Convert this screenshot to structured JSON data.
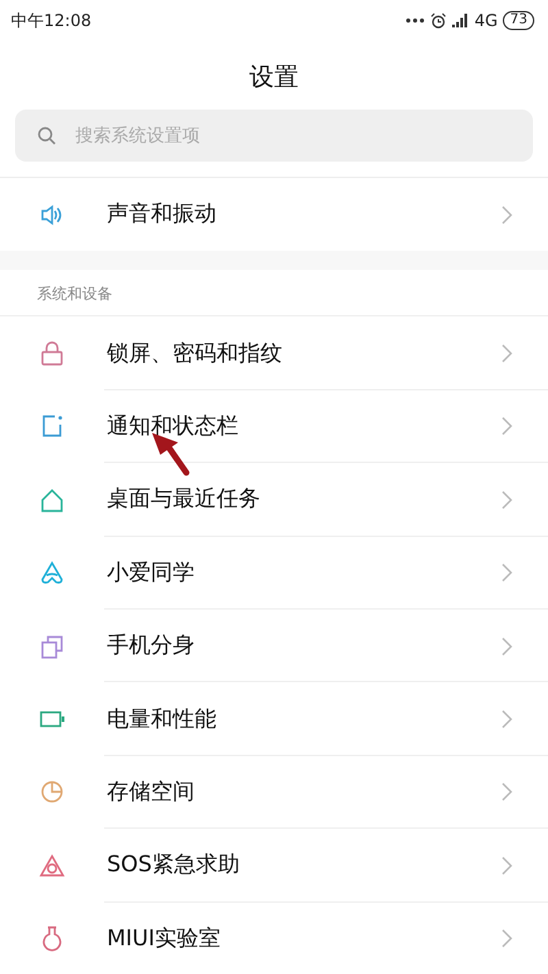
{
  "status_bar": {
    "time": "中午12:08",
    "network": "4G",
    "battery": "73"
  },
  "title": "设置",
  "search": {
    "placeholder": "搜索系统设置项"
  },
  "top_items": [
    {
      "kind": "sound",
      "label": "声音和振动"
    }
  ],
  "section": {
    "title": "系统和设备",
    "items": [
      {
        "kind": "lock",
        "label": "锁屏、密码和指纹"
      },
      {
        "kind": "notification",
        "label": "通知和状态栏"
      },
      {
        "kind": "home",
        "label": "桌面与最近任务"
      },
      {
        "kind": "assistant",
        "label": "小爱同学"
      },
      {
        "kind": "clone",
        "label": "手机分身"
      },
      {
        "kind": "battery",
        "label": "电量和性能"
      },
      {
        "kind": "storage",
        "label": "存储空间"
      },
      {
        "kind": "sos",
        "label": "SOS紧急求助"
      },
      {
        "kind": "lab",
        "label": "MIUI实验室"
      }
    ]
  }
}
